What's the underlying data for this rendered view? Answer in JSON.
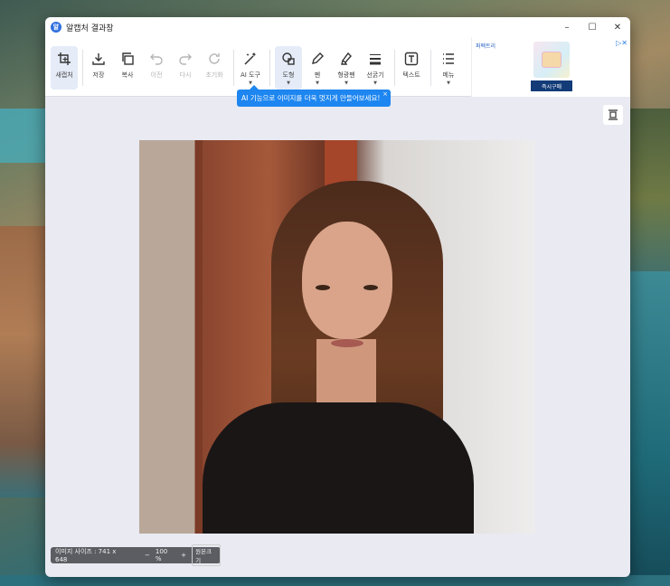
{
  "window": {
    "title": "알캡처 결과창",
    "app_icon_glyph": "알",
    "controls": {
      "minimize": "–",
      "maximize": "☐",
      "close": "✕"
    }
  },
  "toolbar": {
    "items": [
      {
        "label": "새캡처",
        "icon": "crop-icon",
        "state": "active"
      },
      {
        "label": "저장",
        "icon": "download-icon",
        "state": "normal"
      },
      {
        "label": "복사",
        "icon": "copy-icon",
        "state": "normal"
      },
      {
        "label": "이전",
        "icon": "undo-icon",
        "state": "disabled"
      },
      {
        "label": "다시",
        "icon": "redo-icon",
        "state": "disabled"
      },
      {
        "label": "초기화",
        "icon": "reset-icon",
        "state": "disabled"
      },
      {
        "label": "AI 도구",
        "icon": "magic-wand-icon",
        "state": "normal",
        "dropdown": true
      },
      {
        "label": "도형",
        "icon": "shape-icon",
        "state": "active",
        "dropdown": true
      },
      {
        "label": "펜",
        "icon": "pen-icon",
        "state": "normal",
        "dropdown": true
      },
      {
        "label": "형광펜",
        "icon": "highlighter-icon",
        "state": "normal",
        "dropdown": true
      },
      {
        "label": "선굵기",
        "icon": "line-weight-icon",
        "state": "normal",
        "dropdown": true
      },
      {
        "label": "텍스트",
        "icon": "text-icon",
        "state": "normal"
      },
      {
        "label": "메뉴",
        "icon": "menu-list-icon",
        "state": "normal",
        "dropdown": true
      }
    ]
  },
  "ad": {
    "brand": "퍼펙트리",
    "buy_label": "즉시구매",
    "controls": "▷✕"
  },
  "tooltip": {
    "text": "AI 기능으로 이미지를 더욱 멋지게 만들어보세요!",
    "close": "×"
  },
  "statusbar": {
    "size_label": "이미지 사이즈 : 741 x 648",
    "zoom_minus": "−",
    "zoom_value": "100 %",
    "zoom_plus": "+",
    "original_size_label": "원본크기"
  },
  "colors": {
    "accent": "#1e86f0",
    "window_bg": "#e9eaf2",
    "statusbar_bg": "#5c5d62",
    "ad_button": "#123b78"
  }
}
